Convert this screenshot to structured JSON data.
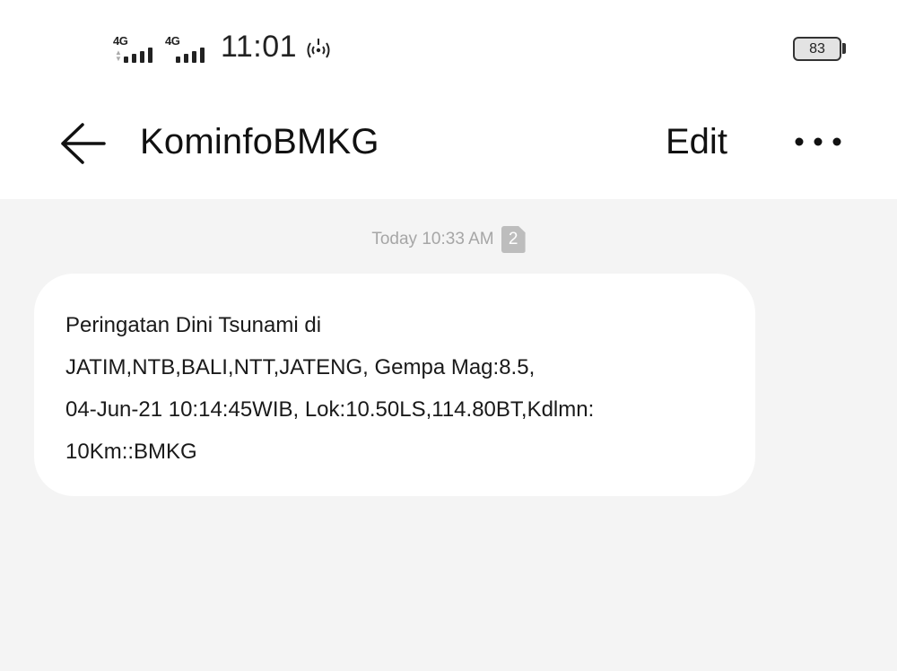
{
  "status_bar": {
    "network_1": "4G",
    "network_2": "4G",
    "time": "11:01",
    "battery": "83",
    "icons": [
      "signal-icon",
      "signal-icon",
      "hotspot-icon",
      "battery-icon"
    ]
  },
  "header": {
    "back_icon": "arrow-left-icon",
    "title": "KominfoBMKG",
    "edit_label": "Edit",
    "more_icon": "more-dots-icon"
  },
  "conversation": {
    "timestamp": "Today 10:33 AM",
    "sim_slot": "2",
    "messages": [
      {
        "lines": [
          "Peringatan Dini Tsunami di",
          "JATIM,NTB,BALI,NTT,JATENG, Gempa Mag:8.5,",
          "04-Jun-21 10:14:45WIB, Lok:10.50LS,114.80BT,Kdlmn:",
          "10Km::BMKG"
        ]
      }
    ]
  },
  "colors": {
    "header_background": "#ffffff",
    "page_background": "#f4f4f4",
    "bubble_background": "#ffffff",
    "timestamp_text": "#a6a6a6",
    "sim_badge": "#bdbdbd"
  }
}
